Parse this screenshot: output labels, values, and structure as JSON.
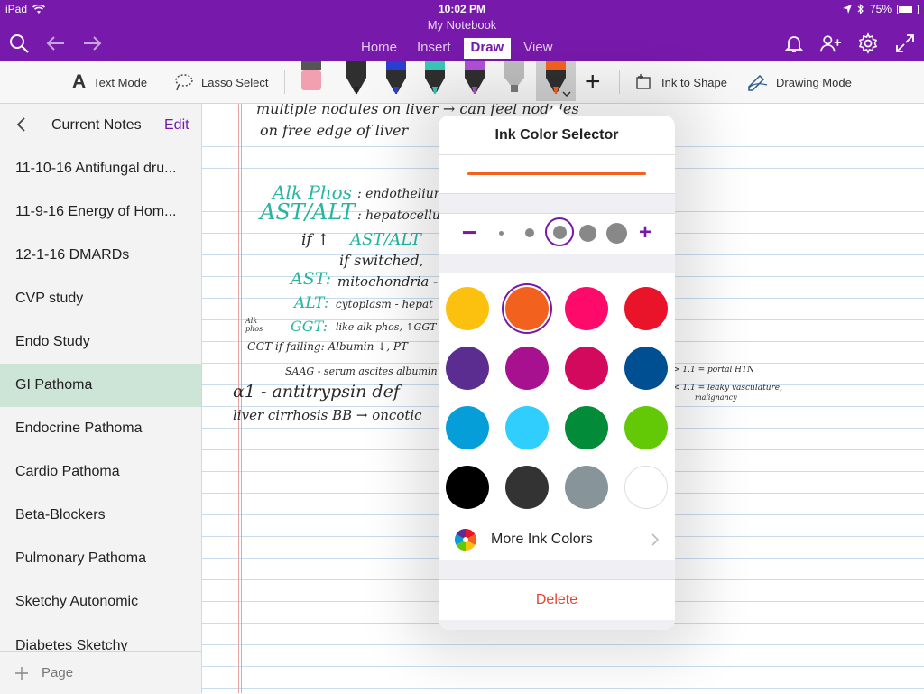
{
  "status_bar": {
    "device": "iPad",
    "time": "10:02 PM",
    "battery": "75%",
    "battery_level": 0.75
  },
  "app": {
    "notebook_title": "My Notebook"
  },
  "ribbon": {
    "tabs": [
      {
        "label": "Home",
        "active": false
      },
      {
        "label": "Insert",
        "active": false
      },
      {
        "label": "Draw",
        "active": true
      },
      {
        "label": "View",
        "active": false
      }
    ],
    "left_icons": [
      "search-icon",
      "undo-icon",
      "redo-icon"
    ],
    "right_icons": [
      "bell-icon",
      "add-person-icon",
      "gear-icon",
      "expand-icon"
    ]
  },
  "toolbar": {
    "text_mode_glyph": "A",
    "text_mode": "Text Mode",
    "lasso_select": "Lasso Select",
    "ink_to_shape": "Ink to Shape",
    "drawing_mode": "Drawing Mode",
    "pens": [
      {
        "name": "eraser",
        "color": "#f2a0b0"
      },
      {
        "name": "pen-black",
        "color": "#222222"
      },
      {
        "name": "pen-blue",
        "color": "#2a3fd1"
      },
      {
        "name": "pen-teal",
        "color": "#38c7b8"
      },
      {
        "name": "pen-purple",
        "color": "#b14fd6"
      },
      {
        "name": "highlighter-gray",
        "color": "#9a9a9a"
      },
      {
        "name": "pen-orange",
        "color": "#f2621e",
        "selected": true
      }
    ],
    "add_pen_glyph": "+"
  },
  "sidebar": {
    "title": "Current Notes",
    "edit_label": "Edit",
    "pages": [
      {
        "label": "11-10-16 Antifungal dru...",
        "active": false
      },
      {
        "label": "11-9-16 Energy of Hom...",
        "active": false
      },
      {
        "label": "12-1-16 DMARDs",
        "active": false
      },
      {
        "label": "CVP study",
        "active": false
      },
      {
        "label": "Endo Study",
        "active": false
      },
      {
        "label": "GI Pathoma",
        "active": true
      },
      {
        "label": "Endocrine Pathoma",
        "active": false
      },
      {
        "label": "Cardio Pathoma",
        "active": false
      },
      {
        "label": "Beta-Blockers",
        "active": false
      },
      {
        "label": "Pulmonary Pathoma",
        "active": false
      },
      {
        "label": "Sketchy Autonomic",
        "active": false
      },
      {
        "label": "Diabetes Sketchy",
        "active": false
      }
    ],
    "add_page_label": "Page"
  },
  "notes": {
    "lines": [
      {
        "text": "multiple nodules on liver → can feel nodules",
        "color": "black"
      },
      {
        "text": "on free edge of liver",
        "color": "black"
      },
      {
        "text": "Alk Phos",
        "color": "teal"
      },
      {
        "text": ": endothelium",
        "color": "black"
      },
      {
        "text": "AST/ALT",
        "color": "teal"
      },
      {
        "text": ": hepatocellula",
        "color": "black"
      },
      {
        "text": "if ↑",
        "color": "black"
      },
      {
        "text": "AST/ALT",
        "color": "teal"
      },
      {
        "text": "if switched,",
        "color": "black"
      },
      {
        "text": "AST:",
        "color": "teal"
      },
      {
        "text": "mitochondria -",
        "color": "black"
      },
      {
        "text": "ALT:",
        "color": "teal"
      },
      {
        "text": "cytoplasm - hepat",
        "color": "black"
      },
      {
        "text": "Alk phos",
        "color": "black"
      },
      {
        "text": "GGT:",
        "color": "teal"
      },
      {
        "text": "like alk phos, ↑GGT +",
        "color": "black"
      },
      {
        "text": "GGT if failing: Albumin ↓, PT",
        "color": "black"
      },
      {
        "text": "SAAG - serum ascites albumin",
        "color": "black"
      },
      {
        "text": "α1 - antitrypsin def",
        "color": "black"
      },
      {
        "text": "liver cirrhosis BB → oncotic",
        "color": "black"
      },
      {
        "text": "> 1.1 = portal HTN",
        "color": "black"
      },
      {
        "text": "< 1.1 = leaky vasculature,",
        "color": "black"
      },
      {
        "text": "malignancy",
        "color": "black"
      }
    ]
  },
  "ink_color_selector": {
    "title": "Ink Color Selector",
    "preview_color": "#f2621e",
    "thickness": {
      "minus": "−",
      "plus": "+",
      "levels": 5,
      "selected": 3
    },
    "swatches": [
      {
        "name": "yellow",
        "color": "#fcc10f"
      },
      {
        "name": "orange",
        "color": "#f2621e",
        "selected": true
      },
      {
        "name": "pink",
        "color": "#fd0a6b"
      },
      {
        "name": "red",
        "color": "#e9132a"
      },
      {
        "name": "purple",
        "color": "#5c2d91"
      },
      {
        "name": "magenta",
        "color": "#a7108f"
      },
      {
        "name": "crimson",
        "color": "#d3095d"
      },
      {
        "name": "navy",
        "color": "#004f93"
      },
      {
        "name": "blue",
        "color": "#069ed9"
      },
      {
        "name": "light-blue",
        "color": "#2fcefd"
      },
      {
        "name": "green",
        "color": "#028b38"
      },
      {
        "name": "lime",
        "color": "#63c806"
      },
      {
        "name": "black",
        "color": "#000000"
      },
      {
        "name": "dark-gray",
        "color": "#333333"
      },
      {
        "name": "gray",
        "color": "#87959b"
      },
      {
        "name": "white",
        "color": "#ffffff"
      }
    ],
    "more_colors_label": "More Ink Colors",
    "delete_label": "Delete"
  },
  "accent_color": "#7719AA"
}
